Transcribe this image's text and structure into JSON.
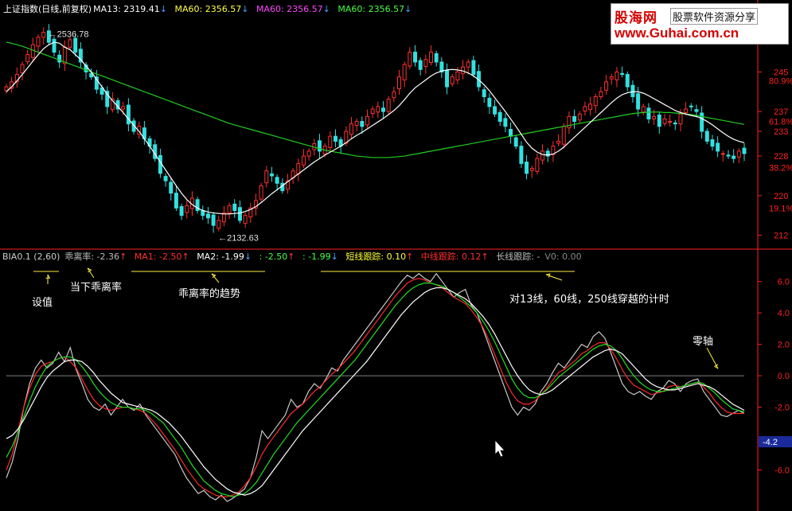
{
  "colors": {
    "up": "#ff3030",
    "down": "#33e0e0",
    "ma13": "#ffffff",
    "ma60": "#22cc22",
    "bias": "#c8c8c8",
    "ma1": "#ff2a2a",
    "ma2_line": "#22dd22",
    "ma3_line": "#ffffff",
    "axis": "#ff2020",
    "zero": "#808080",
    "annotation": "#ffee44",
    "current_box": "#1a2a9a"
  },
  "main_legend": {
    "title": "上证指数(日线,前复权)",
    "ma13": "MA13: 2319.41",
    "ma60a": "MA60: 2356.57",
    "ma60b": "MA60: 2356.57",
    "ma60c": "MA60: 2356.57"
  },
  "ind_legend": {
    "name": "BIA0.1 (2,60)",
    "bias": "乖离率: -2.36",
    "ma1": "MA1: -2.50",
    "ma2": "MA2: -1.99",
    "v3": ": -2.50",
    "v4": ": -1.99",
    "short": "短线跟踪: 0.10",
    "mid": "中线跟踪: 0.12",
    "long": "长线跟踪: -",
    "v0": "V0: 0.00"
  },
  "annotations": {
    "setval": "设值",
    "current": "当下乖离率",
    "trend": "乖离率的趋势",
    "cross": "对13线，60线，250线穿越的计时",
    "zero": "零轴"
  },
  "price_labels": {
    "high": "2536.78",
    "low": "2132.63"
  },
  "logo": {
    "cn": "股海网",
    "tag": "股票软件资源分享",
    "url": "www.Guhai.com.cn"
  },
  "chart_data": [
    {
      "type": "candlestick",
      "ylim": [
        2100,
        2560
      ],
      "price_ticks": [
        {
          "value": 2450,
          "label": "245"
        },
        {
          "value": 2370,
          "label": "237"
        },
        {
          "value": 2330,
          "label": "233"
        },
        {
          "value": 2280,
          "label": "228"
        },
        {
          "value": 2200,
          "label": "220"
        },
        {
          "value": 2120,
          "label": "212"
        }
      ],
      "pct_ticks": [
        {
          "value": 2432,
          "label": "80.9%"
        },
        {
          "value": 2350,
          "label": "61.8%"
        },
        {
          "value": 2257,
          "label": "38.2%"
        },
        {
          "value": 2175,
          "label": "19.1%"
        }
      ],
      "close": [
        2420,
        2430,
        2445,
        2465,
        2485,
        2505,
        2520,
        2530,
        2510,
        2490,
        2470,
        2500,
        2515,
        2490,
        2470,
        2450,
        2440,
        2415,
        2405,
        2380,
        2395,
        2375,
        2380,
        2345,
        2330,
        2340,
        2315,
        2300,
        2275,
        2245,
        2230,
        2205,
        2175,
        2160,
        2180,
        2195,
        2170,
        2160,
        2155,
        2140,
        2150,
        2165,
        2180,
        2170,
        2150,
        2160,
        2175,
        2190,
        2220,
        2250,
        2240,
        2225,
        2210,
        2230,
        2250,
        2265,
        2280,
        2290,
        2305,
        2290,
        2300,
        2320,
        2310,
        2300,
        2330,
        2345,
        2350,
        2340,
        2360,
        2375,
        2380,
        2370,
        2395,
        2410,
        2440,
        2465,
        2490,
        2470,
        2455,
        2475,
        2490,
        2470,
        2450,
        2420,
        2440,
        2450,
        2460,
        2470,
        2445,
        2420,
        2400,
        2380,
        2365,
        2350,
        2340,
        2320,
        2300,
        2265,
        2245,
        2255,
        2275,
        2290,
        2280,
        2300,
        2310,
        2340,
        2360,
        2350,
        2365,
        2380,
        2385,
        2400,
        2410,
        2430,
        2440,
        2450,
        2445,
        2420,
        2400,
        2375,
        2380,
        2355,
        2360,
        2340,
        2355,
        2350,
        2345,
        2365,
        2375,
        2380,
        2370,
        2330,
        2310,
        2300,
        2290,
        2285,
        2280,
        2275,
        2290,
        2285
      ],
      "ma13": [
        2410,
        2420,
        2432,
        2445,
        2458,
        2472,
        2485,
        2497,
        2505,
        2510,
        2508,
        2500,
        2495,
        2485,
        2475,
        2462,
        2450,
        2435,
        2420,
        2405,
        2392,
        2380,
        2368,
        2355,
        2342,
        2330,
        2315,
        2300,
        2284,
        2268,
        2252,
        2236,
        2220,
        2205,
        2192,
        2182,
        2175,
        2170,
        2167,
        2165,
        2164,
        2163,
        2163,
        2164,
        2165,
        2168,
        2172,
        2178,
        2186,
        2195,
        2204,
        2212,
        2220,
        2228,
        2236,
        2244,
        2252,
        2260,
        2268,
        2275,
        2282,
        2288,
        2294,
        2300,
        2307,
        2315,
        2322,
        2328,
        2335,
        2342,
        2349,
        2356,
        2364,
        2372,
        2382,
        2394,
        2407,
        2418,
        2426,
        2434,
        2442,
        2448,
        2452,
        2454,
        2455,
        2454,
        2452,
        2448,
        2442,
        2434,
        2424,
        2412,
        2398,
        2384,
        2370,
        2355,
        2340,
        2324,
        2308,
        2296,
        2288,
        2283,
        2282,
        2284,
        2290,
        2298,
        2308,
        2318,
        2328,
        2338,
        2348,
        2358,
        2368,
        2378,
        2388,
        2397,
        2404,
        2408,
        2410,
        2410,
        2407,
        2402,
        2396,
        2390,
        2384,
        2378,
        2372,
        2368,
        2365,
        2362,
        2360,
        2356,
        2350,
        2343,
        2335,
        2327,
        2320,
        2314,
        2310,
        2307
      ],
      "ma60": [
        2510,
        2508,
        2505,
        2502,
        2498,
        2494,
        2490,
        2486,
        2482,
        2478,
        2474,
        2470,
        2466,
        2462,
        2458,
        2454,
        2450,
        2446,
        2442,
        2438,
        2434,
        2430,
        2426,
        2422,
        2418,
        2414,
        2410,
        2406,
        2402,
        2398,
        2394,
        2390,
        2386,
        2382,
        2378,
        2374,
        2370,
        2366,
        2362,
        2358,
        2354,
        2350,
        2346,
        2343,
        2340,
        2337,
        2334,
        2331,
        2328,
        2325,
        2322,
        2319,
        2316,
        2313,
        2310,
        2307,
        2304,
        2301,
        2298,
        2295,
        2292,
        2290,
        2288,
        2286,
        2284,
        2282,
        2280,
        2279,
        2278,
        2277,
        2277,
        2277,
        2277,
        2278,
        2279,
        2280,
        2282,
        2284,
        2286,
        2288,
        2290,
        2292,
        2294,
        2296,
        2298,
        2300,
        2302,
        2304,
        2306,
        2308,
        2310,
        2312,
        2314,
        2316,
        2318,
        2320,
        2322,
        2324,
        2326,
        2328,
        2330,
        2332,
        2334,
        2336,
        2338,
        2340,
        2342,
        2344,
        2346,
        2348,
        2350,
        2352,
        2354,
        2356,
        2358,
        2360,
        2362,
        2364,
        2366,
        2367,
        2368,
        2369,
        2369,
        2369,
        2368,
        2368,
        2367,
        2366,
        2365,
        2364,
        2362,
        2360,
        2358,
        2356,
        2354,
        2352,
        2350,
        2348,
        2346,
        2344
      ]
    },
    {
      "type": "line",
      "ylim": [
        -8,
        7.2
      ],
      "y_ticks": [
        6.0,
        4.0,
        2.0,
        0.0,
        -2.0,
        -6.0
      ],
      "current_value": "-4.2",
      "series": [
        {
          "name": "乖离率",
          "values": [
            -6.5,
            -5.5,
            -4.0,
            -2.0,
            -0.5,
            0.5,
            1.0,
            0.5,
            0.8,
            1.5,
            0.9,
            1.8,
            0.4,
            -0.5,
            -1.5,
            -2.0,
            -2.2,
            -1.8,
            -2.5,
            -2.0,
            -1.5,
            -2.0,
            -2.2,
            -1.8,
            -2.5,
            -3.0,
            -3.5,
            -4.0,
            -4.5,
            -5.0,
            -5.8,
            -6.5,
            -7.0,
            -7.5,
            -7.3,
            -7.7,
            -7.9,
            -7.6,
            -8.0,
            -7.8,
            -7.5,
            -7.2,
            -6.5,
            -5.2,
            -3.5,
            -4.0,
            -3.5,
            -3.0,
            -2.5,
            -1.5,
            -2.0,
            -1.8,
            -1.0,
            -0.5,
            -0.8,
            -0.2,
            0.5,
            0.3,
            1.0,
            1.5,
            2.0,
            2.5,
            3.0,
            3.5,
            4.0,
            4.5,
            5.0,
            5.5,
            6.0,
            6.4,
            6.2,
            6.5,
            6.2,
            6.0,
            6.5,
            6.0,
            5.5,
            5.0,
            5.3,
            5.5,
            4.5,
            4.0,
            3.0,
            2.0,
            1.0,
            0.0,
            -1.0,
            -2.0,
            -2.5,
            -2.0,
            -2.2,
            -1.8,
            -1.0,
            -0.5,
            0.2,
            0.8,
            0.5,
            1.0,
            1.5,
            2.0,
            1.8,
            2.5,
            2.8,
            2.4,
            1.5,
            0.5,
            -0.5,
            -1.0,
            -1.2,
            -1.0,
            -1.3,
            -1.5,
            -1.0,
            -0.8,
            -0.3,
            -0.5,
            -1.0,
            -0.5,
            -0.3,
            -0.2,
            -1.0,
            -1.5,
            -2.0,
            -2.5,
            -2.6,
            -2.4,
            -2.2,
            -2.4
          ]
        },
        {
          "name": "MA1",
          "values": [
            -6.0,
            -5.0,
            -3.5,
            -2.0,
            -0.8,
            0.1,
            0.6,
            0.8,
            0.9,
            1.1,
            1.2,
            0.9,
            0.5,
            -0.2,
            -0.9,
            -1.5,
            -1.9,
            -2.1,
            -2.2,
            -2.1,
            -2.0,
            -2.0,
            -2.1,
            -2.2,
            -2.4,
            -2.8,
            -3.2,
            -3.7,
            -4.2,
            -4.7,
            -5.3,
            -5.9,
            -6.4,
            -6.9,
            -7.2,
            -7.4,
            -7.6,
            -7.7,
            -7.7,
            -7.6,
            -7.4,
            -7.0,
            -6.5,
            -5.8,
            -5.0,
            -4.4,
            -3.9,
            -3.4,
            -2.9,
            -2.4,
            -2.1,
            -1.8,
            -1.4,
            -1.0,
            -0.7,
            -0.3,
            0.1,
            0.4,
            0.8,
            1.2,
            1.6,
            2.1,
            2.6,
            3.1,
            3.6,
            4.1,
            4.6,
            5.1,
            5.5,
            5.9,
            6.1,
            6.2,
            6.1,
            5.9,
            5.8,
            5.6,
            5.3,
            5.0,
            4.8,
            4.6,
            4.2,
            3.7,
            3.1,
            2.3,
            1.4,
            0.5,
            -0.4,
            -1.1,
            -1.6,
            -1.8,
            -1.8,
            -1.6,
            -1.2,
            -0.8,
            -0.3,
            0.2,
            0.4,
            0.7,
            1.0,
            1.4,
            1.6,
            1.9,
            2.1,
            2.1,
            1.7,
            1.1,
            0.4,
            -0.2,
            -0.6,
            -0.8,
            -1.0,
            -1.2,
            -1.1,
            -1.0,
            -0.7,
            -0.6,
            -0.7,
            -0.6,
            -0.5,
            -0.4,
            -0.7,
            -1.1,
            -1.6,
            -2.0,
            -2.3,
            -2.4,
            -2.4,
            -2.4
          ]
        },
        {
          "name": "MA2",
          "values": [
            -5.2,
            -4.5,
            -3.6,
            -2.6,
            -1.6,
            -0.7,
            0.0,
            0.6,
            0.9,
            1.1,
            1.2,
            1.2,
            1.0,
            0.6,
            0.1,
            -0.5,
            -1.0,
            -1.4,
            -1.7,
            -1.9,
            -2.0,
            -2.0,
            -2.1,
            -2.1,
            -2.2,
            -2.4,
            -2.7,
            -3.0,
            -3.5,
            -4.0,
            -4.5,
            -5.1,
            -5.7,
            -6.2,
            -6.7,
            -7.0,
            -7.3,
            -7.5,
            -7.6,
            -7.7,
            -7.6,
            -7.5,
            -7.2,
            -6.8,
            -6.2,
            -5.6,
            -5.0,
            -4.5,
            -4.0,
            -3.5,
            -3.0,
            -2.6,
            -2.2,
            -1.8,
            -1.4,
            -1.0,
            -0.6,
            -0.2,
            0.2,
            0.6,
            1.0,
            1.5,
            2.0,
            2.5,
            3.0,
            3.5,
            4.0,
            4.5,
            4.9,
            5.3,
            5.6,
            5.8,
            5.9,
            5.9,
            5.8,
            5.7,
            5.5,
            5.3,
            5.0,
            4.7,
            4.4,
            4.0,
            3.5,
            2.9,
            2.2,
            1.4,
            0.6,
            -0.2,
            -0.8,
            -1.2,
            -1.4,
            -1.4,
            -1.2,
            -0.9,
            -0.5,
            -0.1,
            0.2,
            0.5,
            0.8,
            1.1,
            1.4,
            1.7,
            1.9,
            2.0,
            1.9,
            1.6,
            1.1,
            0.5,
            0.0,
            -0.4,
            -0.7,
            -0.9,
            -1.0,
            -1.0,
            -0.9,
            -0.8,
            -0.7,
            -0.6,
            -0.5,
            -0.4,
            -0.5,
            -0.8,
            -1.1,
            -1.5,
            -1.8,
            -2.1,
            -2.2,
            -2.3
          ]
        },
        {
          "name": "MA3",
          "values": [
            -4.0,
            -3.8,
            -3.4,
            -2.8,
            -2.1,
            -1.4,
            -0.7,
            -0.1,
            0.3,
            0.6,
            0.9,
            1.0,
            1.0,
            0.9,
            0.6,
            0.2,
            -0.3,
            -0.7,
            -1.1,
            -1.4,
            -1.7,
            -1.8,
            -1.9,
            -2.0,
            -2.1,
            -2.2,
            -2.4,
            -2.7,
            -3.0,
            -3.4,
            -3.8,
            -4.3,
            -4.8,
            -5.3,
            -5.8,
            -6.2,
            -6.6,
            -6.9,
            -7.2,
            -7.4,
            -7.5,
            -7.6,
            -7.5,
            -7.3,
            -7.0,
            -6.5,
            -6.0,
            -5.5,
            -5.0,
            -4.5,
            -4.0,
            -3.5,
            -3.1,
            -2.7,
            -2.3,
            -1.9,
            -1.5,
            -1.1,
            -0.7,
            -0.3,
            0.1,
            0.5,
            0.9,
            1.4,
            1.9,
            2.4,
            2.9,
            3.4,
            3.9,
            4.3,
            4.7,
            5.0,
            5.3,
            5.5,
            5.6,
            5.6,
            5.5,
            5.3,
            5.1,
            4.9,
            4.6,
            4.2,
            3.8,
            3.3,
            2.7,
            2.0,
            1.3,
            0.6,
            0.0,
            -0.5,
            -0.9,
            -1.1,
            -1.2,
            -1.1,
            -0.9,
            -0.6,
            -0.3,
            0.0,
            0.3,
            0.6,
            0.9,
            1.2,
            1.4,
            1.6,
            1.7,
            1.6,
            1.4,
            1.0,
            0.6,
            0.2,
            -0.2,
            -0.5,
            -0.7,
            -0.8,
            -0.9,
            -0.9,
            -0.8,
            -0.7,
            -0.6,
            -0.5,
            -0.6,
            -0.7,
            -0.9,
            -1.2,
            -1.5,
            -1.8,
            -2.0,
            -2.2
          ]
        }
      ]
    }
  ]
}
